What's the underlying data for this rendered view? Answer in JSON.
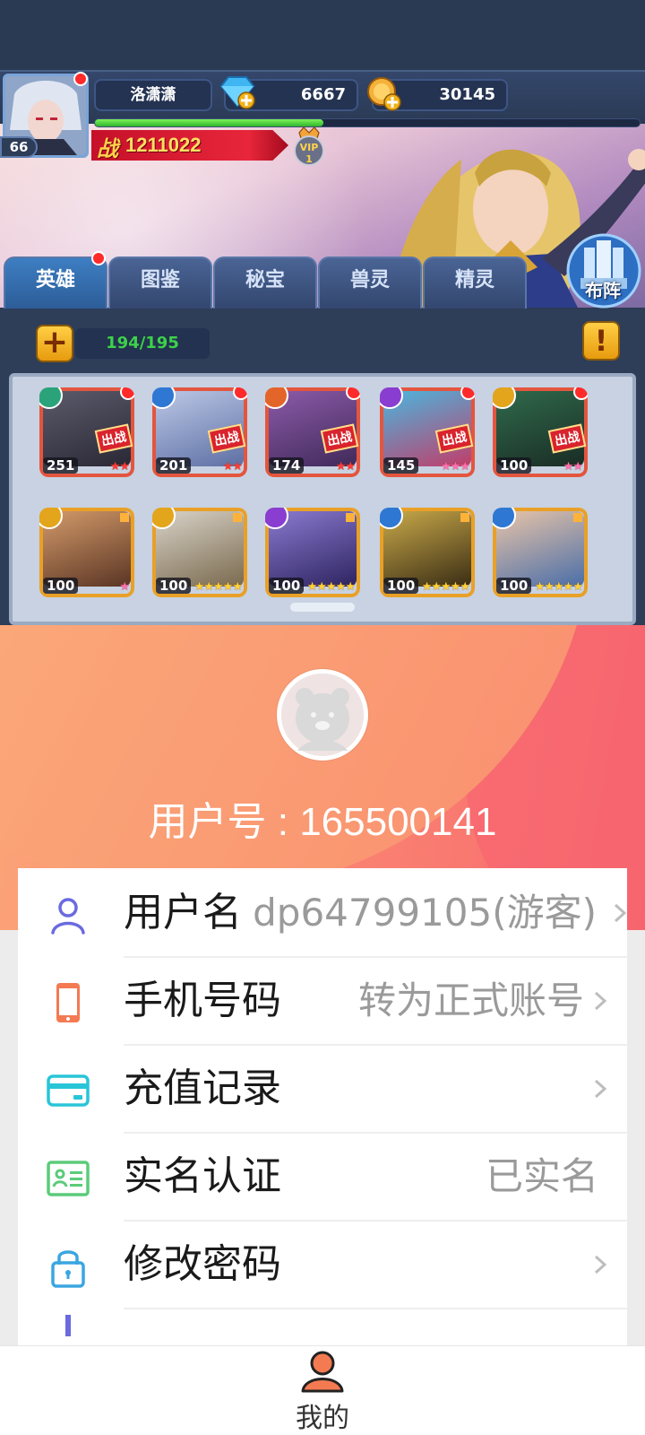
{
  "game": {
    "player_name": "洛潇潇",
    "level": "66",
    "gems": "6667",
    "coins": "30145",
    "xp_progress": 0.42,
    "power_label": "战",
    "power_value": "1211022",
    "vip_label": "VIP",
    "vip_level": "1",
    "tabs": [
      {
        "label": "英雄",
        "active": true
      },
      {
        "label": "图鉴"
      },
      {
        "label": "秘宝"
      },
      {
        "label": "兽灵"
      },
      {
        "label": "精灵"
      }
    ],
    "formation_label": "布阵",
    "hero_count": "194/195",
    "deploy_badge": "出战",
    "heroes": [
      {
        "level": "251",
        "stars": "★★",
        "star_style": "red",
        "deployed": true,
        "faction_color": "#2aa37a",
        "art": [
          "#5c5b6b",
          "#2a2835"
        ]
      },
      {
        "level": "201",
        "stars": "★★",
        "star_style": "red",
        "deployed": true,
        "faction_color": "#2e78d4",
        "art": [
          "#bcc8e6",
          "#5d6fa4"
        ]
      },
      {
        "level": "174",
        "stars": "★★",
        "star_style": "red",
        "deployed": true,
        "faction_color": "#e4652a",
        "art": [
          "#8c5aa8",
          "#402a5a"
        ]
      },
      {
        "level": "145",
        "stars": "★★★",
        "star_style": "pink",
        "deployed": true,
        "faction_color": "#8a3dd1",
        "art": [
          "#4ab6de",
          "#c13d6a"
        ]
      },
      {
        "level": "100",
        "stars": "★★",
        "star_style": "pink",
        "deployed": true,
        "faction_color": "#e3a51c",
        "art": [
          "#2f6a4b",
          "#1a2c25"
        ]
      },
      {
        "level": "100",
        "stars": "★",
        "star_style": "pink",
        "deployed": false,
        "faction_color": "#e3a51c",
        "art": [
          "#d39a6a",
          "#5a3524"
        ]
      },
      {
        "level": "100",
        "stars": "★★★★★",
        "star_style": "gold",
        "deployed": false,
        "faction_color": "#e3a51c",
        "art": [
          "#d8d2c8",
          "#7a6a4e"
        ]
      },
      {
        "level": "100",
        "stars": "★★★★★",
        "star_style": "gold",
        "deployed": false,
        "faction_color": "#8a3dd1",
        "art": [
          "#8a7ad0",
          "#2e2460"
        ]
      },
      {
        "level": "100",
        "stars": "★★★★★",
        "star_style": "gold",
        "deployed": false,
        "faction_color": "#2e78d4",
        "art": [
          "#c9a94a",
          "#3a2d14"
        ]
      },
      {
        "level": "100",
        "stars": "★★★★★",
        "star_style": "gold",
        "deployed": false,
        "faction_color": "#2e78d4",
        "art": [
          "#e8c4a8",
          "#4a6ea8"
        ]
      }
    ]
  },
  "account": {
    "user_id_text": "用户号 : 165500141",
    "rows": [
      {
        "label": "用户名",
        "value": "dp64799105(游客)",
        "icon": "user-icon",
        "chevron": true
      },
      {
        "label": "手机号码",
        "value": "转为正式账号",
        "icon": "phone-icon",
        "chevron": true
      },
      {
        "label": "充值记录",
        "value": "",
        "icon": "card-icon",
        "chevron": true
      },
      {
        "label": "实名认证",
        "value": "已实名",
        "icon": "id-card-icon",
        "chevron": false
      },
      {
        "label": "修改密码",
        "value": "",
        "icon": "lock-icon",
        "chevron": true
      }
    ]
  },
  "nav": {
    "label": "我的"
  },
  "colors": {
    "accent_orange": "#f98a6e",
    "user_icon": "#6a6ae0",
    "phone_icon": "#f47a52",
    "card_icon": "#28c5d8",
    "id_icon": "#5ccb7a",
    "lock_icon": "#3aa6e0"
  }
}
